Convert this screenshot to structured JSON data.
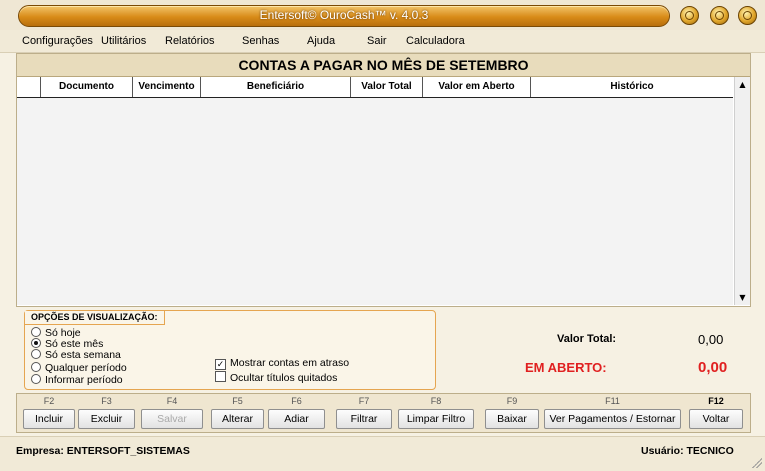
{
  "window": {
    "title": "Entersoft© OuroCash™ v. 4.0.3"
  },
  "menu": {
    "items": [
      "Configurações",
      "Utilitários",
      "Relatórios",
      "Senhas",
      "Ajuda",
      "Sair",
      "Calculadora"
    ]
  },
  "main": {
    "heading": "CONTAS A PAGAR NO MÊS DE SETEMBRO",
    "columns": [
      "Documento",
      "Vencimento",
      "Beneficiário",
      "Valor Total",
      "Valor em Aberto",
      "Histórico"
    ]
  },
  "options": {
    "title": "OPÇÕES DE VISUALIZAÇÃO:",
    "radios": [
      {
        "label": "Só hoje",
        "selected": false
      },
      {
        "label": "Só este mês",
        "selected": true
      },
      {
        "label": "Só esta semana",
        "selected": false
      },
      {
        "label": "Qualquer período",
        "selected": false
      },
      {
        "label": "Informar período",
        "selected": false
      }
    ],
    "checkboxes": [
      {
        "label": "Mostrar contas em atraso",
        "checked": true
      },
      {
        "label": "Ocultar títulos quitados",
        "checked": false
      }
    ]
  },
  "totals": {
    "total_label": "Valor Total:",
    "total_value": "0,00",
    "open_label": "EM ABERTO:",
    "open_value": "0,00"
  },
  "fkeys": [
    {
      "key": "F2",
      "label": "Incluir",
      "enabled": true
    },
    {
      "key": "F3",
      "label": "Excluir",
      "enabled": true
    },
    {
      "key": "F4",
      "label": "Salvar",
      "enabled": false
    },
    {
      "key": "F5",
      "label": "Alterar",
      "enabled": true
    },
    {
      "key": "F6",
      "label": "Adiar",
      "enabled": true
    },
    {
      "key": "F7",
      "label": "Filtrar",
      "enabled": true
    },
    {
      "key": "F8",
      "label": "Limpar Filtro",
      "enabled": true
    },
    {
      "key": "F9",
      "label": "Baixar",
      "enabled": true
    },
    {
      "key": "F11",
      "label": "Ver Pagamentos / Estornar",
      "enabled": true
    },
    {
      "key": "F12",
      "label": "Voltar",
      "enabled": true
    }
  ],
  "status": {
    "company": "Empresa: ENTERSOFT_SISTEMAS",
    "user": "Usuário: TECNICO"
  },
  "colors": {
    "accent": "#d88b18",
    "alert": "#e02020"
  }
}
